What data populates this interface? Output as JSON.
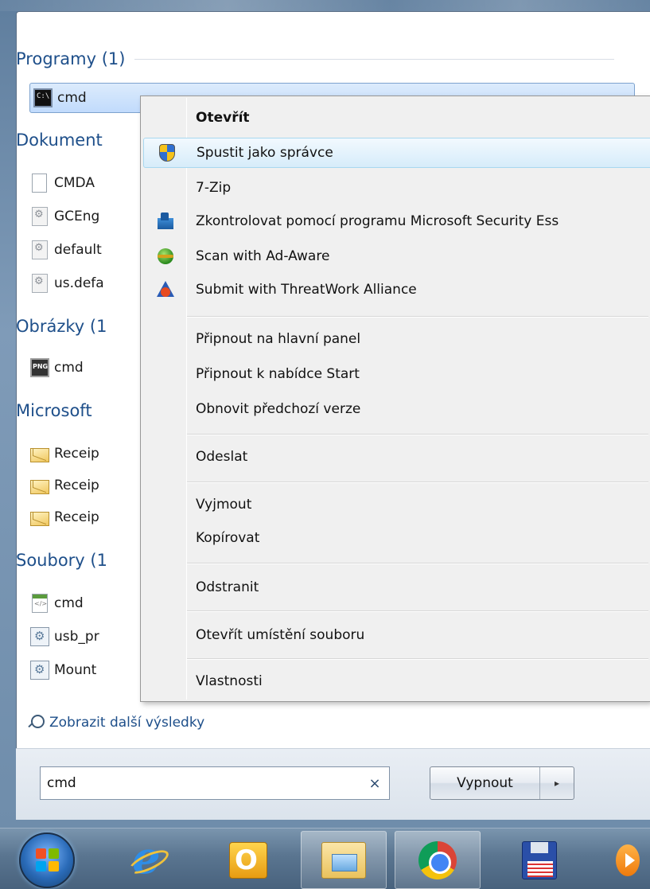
{
  "start_menu": {
    "groups": [
      {
        "header": "Programy (1)",
        "items": [
          {
            "label": "cmd",
            "icon": "cmd-icon",
            "selected": true
          }
        ]
      },
      {
        "header": "Dokument",
        "items": [
          {
            "label": "CMDA",
            "icon": "text-document-icon"
          },
          {
            "label": "GCEng",
            "icon": "config-file-icon"
          },
          {
            "label": "default",
            "icon": "config-file-icon"
          },
          {
            "label": "us.defa",
            "icon": "config-file-icon"
          }
        ]
      },
      {
        "header": "Obrázky (1",
        "items": [
          {
            "label": "cmd",
            "icon": "png-image-icon"
          }
        ]
      },
      {
        "header": "Microsoft",
        "items": [
          {
            "label": "Receip",
            "icon": "mail-envelope-icon"
          },
          {
            "label": "Receip",
            "icon": "mail-envelope-icon"
          },
          {
            "label": "Receip",
            "icon": "mail-envelope-icon"
          }
        ]
      },
      {
        "header": "Soubory (1",
        "items": [
          {
            "label": "cmd",
            "icon": "xml-file-icon"
          },
          {
            "label": "usb_pr",
            "icon": "setup-file-icon"
          },
          {
            "label": "Mount",
            "icon": "setup-file-icon"
          }
        ]
      }
    ],
    "more_results": "Zobrazit další výsledky",
    "search": {
      "value": "cmd",
      "clear": "×"
    },
    "shutdown": {
      "label": "Vypnout",
      "arrow": "▸"
    }
  },
  "context_menu": {
    "items": [
      {
        "label": "Otevřít",
        "bold": true
      },
      {
        "label": "Spustit jako správce",
        "icon": "uac-shield-icon",
        "hover": true
      },
      {
        "label": "7-Zip"
      },
      {
        "label": "Zkontrolovat pomocí programu Microsoft Security Ess",
        "icon": "microsoft-security-essentials-icon"
      },
      {
        "label": "Scan with Ad-Aware",
        "icon": "ad-aware-icon"
      },
      {
        "label": "Submit with ThreatWork Alliance",
        "icon": "threatwork-icon"
      },
      {
        "label": "Připnout na hlavní panel"
      },
      {
        "label": "Připnout k nabídce Start"
      },
      {
        "label": "Obnovit předchozí verze"
      },
      {
        "label": "Odeslat"
      },
      {
        "label": "Vyjmout"
      },
      {
        "label": "Kopírovat"
      },
      {
        "label": "Odstranit"
      },
      {
        "label": "Otevřít umístění souboru"
      },
      {
        "label": "Vlastnosti"
      }
    ]
  },
  "taskbar": {
    "buttons": [
      {
        "icon": "windows-start-orb-icon"
      },
      {
        "icon": "internet-explorer-icon"
      },
      {
        "icon": "outlook-icon"
      },
      {
        "icon": "windows-explorer-icon",
        "active": true
      },
      {
        "icon": "chrome-icon",
        "active": true
      },
      {
        "icon": "floppy-save-icon"
      },
      {
        "icon": "media-player-icon"
      }
    ]
  },
  "colors": {
    "group_header": "#1e4f8a",
    "selection": "#c1dbfc",
    "menu_bg": "#f0f0f0"
  }
}
